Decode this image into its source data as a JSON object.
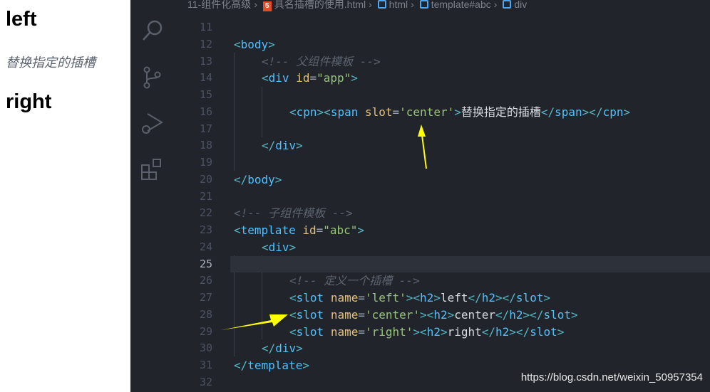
{
  "preview": {
    "left": "left",
    "center": "替换指定的插槽",
    "right": "right"
  },
  "breadcrumb": [
    "11-组件化高级",
    "具名插槽的使用.html",
    "html",
    "template#abc",
    "div"
  ],
  "activity_icons": [
    "search-icon",
    "source-control-icon",
    "run-debug-icon",
    "extensions-icon"
  ],
  "current_line": 25,
  "lines": [
    {
      "n": "11",
      "indent": 0,
      "tokens": []
    },
    {
      "n": "12",
      "indent": 0,
      "tokens": [
        [
          "p",
          "<"
        ],
        [
          "t",
          "body"
        ],
        [
          "p",
          ">"
        ]
      ]
    },
    {
      "n": "13",
      "indent": 1,
      "tokens": [
        [
          "c",
          "<!-- 父组件模板 -->"
        ]
      ]
    },
    {
      "n": "14",
      "indent": 1,
      "tokens": [
        [
          "p",
          "<"
        ],
        [
          "t",
          "div"
        ],
        [
          "x",
          " "
        ],
        [
          "a",
          "id"
        ],
        [
          "e",
          "="
        ],
        [
          "s",
          "\"app\""
        ],
        [
          "p",
          ">"
        ]
      ]
    },
    {
      "n": "15",
      "indent": 0,
      "tokens": []
    },
    {
      "n": "16",
      "indent": 2,
      "tokens": [
        [
          "p",
          "<"
        ],
        [
          "t",
          "cpn"
        ],
        [
          "p",
          "><"
        ],
        [
          "t",
          "span"
        ],
        [
          "x",
          " "
        ],
        [
          "a",
          "slot"
        ],
        [
          "e",
          "="
        ],
        [
          "s",
          "'center'"
        ],
        [
          "p",
          ">"
        ],
        [
          "x",
          "替换指定的插槽"
        ],
        [
          "p",
          "</"
        ],
        [
          "t",
          "span"
        ],
        [
          "p",
          "></"
        ],
        [
          "t",
          "cpn"
        ],
        [
          "p",
          ">"
        ]
      ]
    },
    {
      "n": "17",
      "indent": 0,
      "tokens": []
    },
    {
      "n": "18",
      "indent": 1,
      "tokens": [
        [
          "p",
          "</"
        ],
        [
          "t",
          "div"
        ],
        [
          "p",
          ">"
        ]
      ]
    },
    {
      "n": "19",
      "indent": 0,
      "tokens": []
    },
    {
      "n": "20",
      "indent": 0,
      "tokens": [
        [
          "p",
          "</"
        ],
        [
          "t",
          "body"
        ],
        [
          "p",
          ">"
        ]
      ]
    },
    {
      "n": "21",
      "indent": 0,
      "tokens": []
    },
    {
      "n": "22",
      "indent": 0,
      "tokens": [
        [
          "c",
          "<!-- 子组件模板 -->"
        ]
      ]
    },
    {
      "n": "23",
      "indent": 0,
      "tokens": [
        [
          "p",
          "<"
        ],
        [
          "t",
          "template"
        ],
        [
          "x",
          " "
        ],
        [
          "a",
          "id"
        ],
        [
          "e",
          "="
        ],
        [
          "s",
          "\"abc\""
        ],
        [
          "p",
          ">"
        ]
      ]
    },
    {
      "n": "24",
      "indent": 1,
      "tokens": [
        [
          "p",
          "<"
        ],
        [
          "t",
          "div"
        ],
        [
          "p",
          ">"
        ]
      ]
    },
    {
      "n": "25",
      "indent": 0,
      "tokens": []
    },
    {
      "n": "26",
      "indent": 2,
      "tokens": [
        [
          "c",
          "<!-- 定义一个插槽 -->"
        ]
      ]
    },
    {
      "n": "27",
      "indent": 2,
      "tokens": [
        [
          "p",
          "<"
        ],
        [
          "t",
          "slot"
        ],
        [
          "x",
          " "
        ],
        [
          "a",
          "name"
        ],
        [
          "e",
          "="
        ],
        [
          "s",
          "'left'"
        ],
        [
          "p",
          "><"
        ],
        [
          "t",
          "h2"
        ],
        [
          "p",
          ">"
        ],
        [
          "x",
          "left"
        ],
        [
          "p",
          "</"
        ],
        [
          "t",
          "h2"
        ],
        [
          "p",
          "></"
        ],
        [
          "t",
          "slot"
        ],
        [
          "p",
          ">"
        ]
      ]
    },
    {
      "n": "28",
      "indent": 2,
      "tokens": [
        [
          "p",
          "<"
        ],
        [
          "t",
          "slot"
        ],
        [
          "x",
          " "
        ],
        [
          "a",
          "name"
        ],
        [
          "e",
          "="
        ],
        [
          "s",
          "'center'"
        ],
        [
          "p",
          "><"
        ],
        [
          "t",
          "h2"
        ],
        [
          "p",
          ">"
        ],
        [
          "x",
          "center"
        ],
        [
          "p",
          "</"
        ],
        [
          "t",
          "h2"
        ],
        [
          "p",
          "></"
        ],
        [
          "t",
          "slot"
        ],
        [
          "p",
          ">"
        ]
      ]
    },
    {
      "n": "29",
      "indent": 2,
      "tokens": [
        [
          "p",
          "<"
        ],
        [
          "t",
          "slot"
        ],
        [
          "x",
          " "
        ],
        [
          "a",
          "name"
        ],
        [
          "e",
          "="
        ],
        [
          "s",
          "'right'"
        ],
        [
          "p",
          "><"
        ],
        [
          "t",
          "h2"
        ],
        [
          "p",
          ">"
        ],
        [
          "x",
          "right"
        ],
        [
          "p",
          "</"
        ],
        [
          "t",
          "h2"
        ],
        [
          "p",
          "></"
        ],
        [
          "t",
          "slot"
        ],
        [
          "p",
          ">"
        ]
      ]
    },
    {
      "n": "30",
      "indent": 1,
      "tokens": [
        [
          "p",
          "</"
        ],
        [
          "t",
          "div"
        ],
        [
          "p",
          ">"
        ]
      ]
    },
    {
      "n": "31",
      "indent": 0,
      "tokens": [
        [
          "p",
          "</"
        ],
        [
          "t",
          "template"
        ],
        [
          "p",
          ">"
        ]
      ]
    },
    {
      "n": "32",
      "indent": 0,
      "tokens": []
    }
  ],
  "annotation_color": "#ffff00",
  "watermark": "https://blog.csdn.net/weixin_50957354"
}
